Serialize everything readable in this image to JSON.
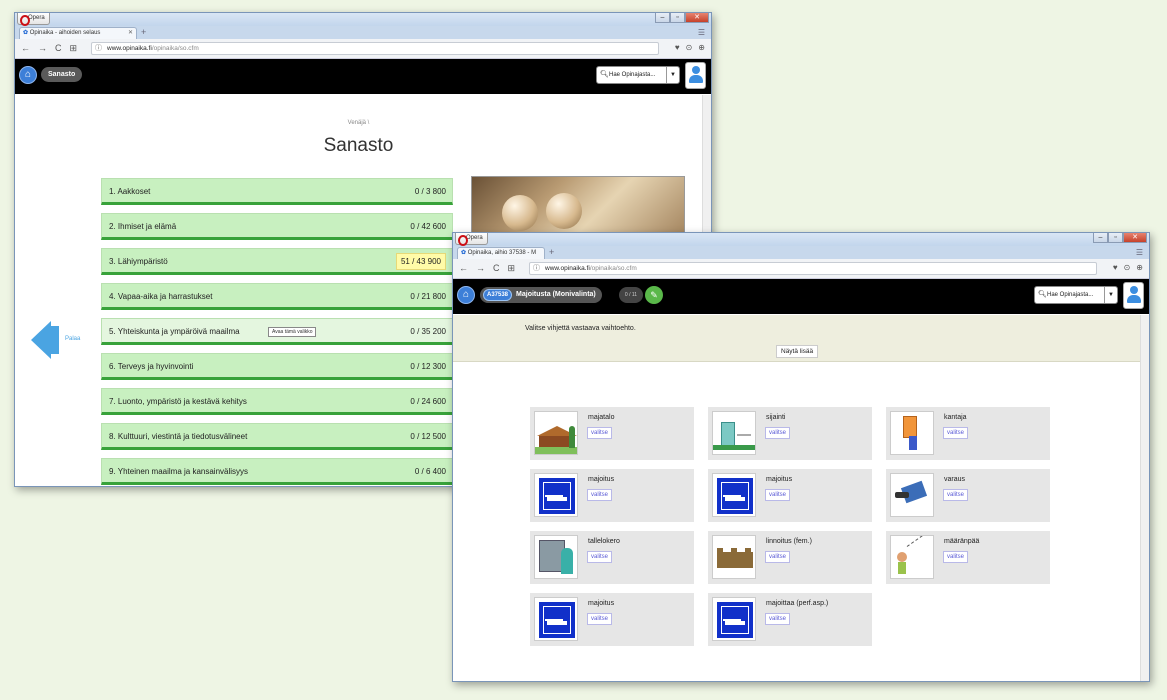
{
  "window1": {
    "opera_label": "Opera",
    "tab_title": "Opinaika - aihoiden selaus",
    "url_domain": "www.opinaika.fi",
    "url_rest": "/opinaika/so.cfm",
    "site_pill": "Sanasto",
    "search_text": "Hae Opinajasta...",
    "breadcrumb": "Venäjä \\",
    "page_title": "Sanasto",
    "back_label": "Palaa",
    "tooltip": "Avaa tämä valikko",
    "items": [
      {
        "label": "1. Aakkoset",
        "count": "0 / 3 800"
      },
      {
        "label": "2. Ihmiset ja elämä",
        "count": "0 / 42 600"
      },
      {
        "label": "3. Lähiympäristö",
        "count": "51 / 43 900"
      },
      {
        "label": "4. Vapaa-aika ja harrastukset",
        "count": "0 / 21 800"
      },
      {
        "label": "5. Yhteiskunta ja ympäröivä maailma",
        "count": "0 / 35 200"
      },
      {
        "label": "6. Terveys ja hyvinvointi",
        "count": "0 / 12 300"
      },
      {
        "label": "7. Luonto, ympäristö ja kestävä kehitys",
        "count": "0 / 24 600"
      },
      {
        "label": "8. Kulttuuri, viestintä ja tiedotusvälineet",
        "count": "0 / 12 500"
      },
      {
        "label": "9. Yhteinen maailma ja kansainvälisyys",
        "count": "0 / 6 400"
      }
    ]
  },
  "window2": {
    "opera_label": "Opera",
    "tab_title": "Opinaika, aihio 37538 - M",
    "url_domain": "www.opinaika.fi",
    "url_rest": "/opinaika/so.cfm",
    "badge": "A37538",
    "exercise_title": "Majoitusta (Monivalinta)",
    "counter": "0 / 11",
    "search_text": "Hae Opinajasta...",
    "prompt": "Valitse vihjettä vastaava vaihtoehto.",
    "show_more": "Näytä lisää",
    "choose_label": "valitse",
    "cards": [
      {
        "word": "majatalo",
        "icon": "inn-picture"
      },
      {
        "word": "sijainti",
        "icon": "location-picture"
      },
      {
        "word": "kantaja",
        "icon": "porter-picture"
      },
      {
        "word": "majoitus",
        "icon": "bed-sign"
      },
      {
        "word": "majoitus",
        "icon": "bed-sign"
      },
      {
        "word": "varaus",
        "icon": "reservation-picture"
      },
      {
        "word": "tallelokero",
        "icon": "safe-box-picture"
      },
      {
        "word": "linnoitus (fem.)",
        "icon": "fortress-picture"
      },
      {
        "word": "määränpää",
        "icon": "destination-picture"
      },
      {
        "word": "majoitus",
        "icon": "bed-sign"
      },
      {
        "word": "majoittaa (perf.asp.)",
        "icon": "bed-sign"
      }
    ]
  }
}
